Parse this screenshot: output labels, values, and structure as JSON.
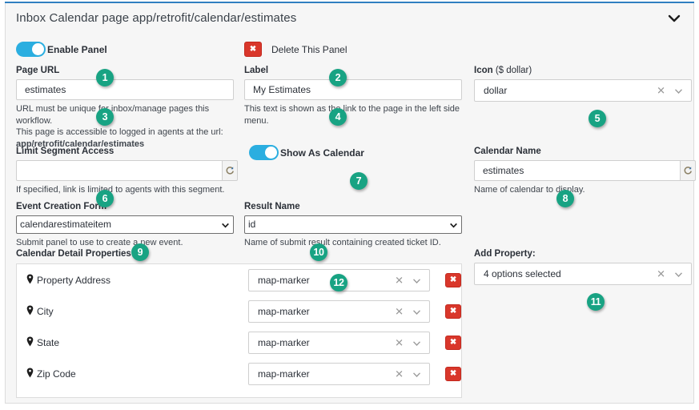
{
  "panel": {
    "title": "Inbox Calendar page app/retrofit/calendar/estimates",
    "collapse_icon": "chevron-down-icon",
    "accent_color": "#2f7fc1"
  },
  "enable_panel": {
    "label": "Enable Panel",
    "state": "on",
    "badge": "1"
  },
  "delete_panel": {
    "label": "Delete This Panel",
    "icon": "times-icon",
    "badge": "2",
    "color": "#d9372b"
  },
  "page_url": {
    "label": "Page URL",
    "value": "estimates",
    "badge": "3",
    "help_line1": "URL must be unique for inbox/manage pages this workflow.",
    "help_line2": "This page is accessible to logged in agents at the url:",
    "help_line3": "app/retrofit/calendar/estimates"
  },
  "label_field": {
    "label": "Label",
    "value": "My Estimates",
    "badge": "4",
    "help": "This text is shown as the link to the page in the left side menu."
  },
  "icon_field": {
    "label_bold": "Icon",
    "label_light": "($ dollar)",
    "value": "dollar",
    "badge": "5",
    "clear_icon": "close-icon",
    "arrow_icon": "chevron-down-icon"
  },
  "limit_segment": {
    "label": "Limit Segment Access",
    "value": "",
    "badge": "6",
    "help": "If specified, link is limited to agents with this segment.",
    "refresh_icon": "refresh-icon"
  },
  "show_as_calendar": {
    "label": "Show As Calendar",
    "state": "on",
    "badge": "7"
  },
  "calendar_name": {
    "label": "Calendar Name",
    "value": "estimates",
    "badge": "8",
    "help": "Name of calendar to display.",
    "refresh_icon": "refresh-icon"
  },
  "event_creation_form": {
    "label": "Event Creation Form",
    "value": "calendarestimateitem",
    "badge": "9",
    "help": "Submit panel to use to create a new event.",
    "caret_icon": "chevron-down-icon"
  },
  "result_name": {
    "label": "Result Name",
    "value": "id",
    "badge": "10",
    "help": "Name of submit result containing created ticket ID.",
    "caret_icon": "chevron-down-icon"
  },
  "add_property": {
    "label": "Add Property:",
    "value": "4 options selected",
    "badge": "11",
    "clear_icon": "close-icon",
    "arrow_icon": "chevron-down-icon"
  },
  "detail_properties": {
    "section_label": "Calendar Detail Properties",
    "first_badge": "12",
    "rows": [
      {
        "name": "Property Address",
        "icon": "map-marker-pin-icon",
        "value": "map-marker",
        "delete_icon": "times-icon"
      },
      {
        "name": "City",
        "icon": "map-marker-pin-icon",
        "value": "map-marker",
        "delete_icon": "times-icon"
      },
      {
        "name": "State",
        "icon": "map-marker-pin-icon",
        "value": "map-marker",
        "delete_icon": "times-icon"
      },
      {
        "name": "Zip Code",
        "icon": "map-marker-pin-icon",
        "value": "map-marker",
        "delete_icon": "times-icon"
      }
    ]
  },
  "colors": {
    "badge": "#18a383",
    "toggle_on": "#2baee0",
    "danger": "#d9372b",
    "panel_accent": "#2f7fc1"
  }
}
